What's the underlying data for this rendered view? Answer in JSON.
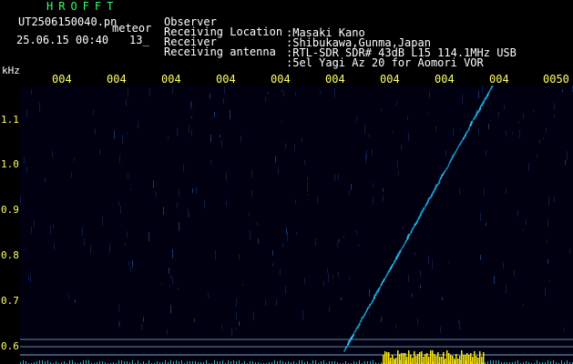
{
  "header": {
    "brand": "HROFFT",
    "filename": "UT2506150040.pn",
    "meteor_label": "meteor",
    "datetime": "25.06.15 00:40",
    "aux_value": "13_",
    "info": [
      {
        "label": "Observer",
        "value": ":Masaki Kano"
      },
      {
        "label": "Receiving Location",
        "value": ":Shibukawa,Gunma,Japan"
      },
      {
        "label": "Receiver",
        "value": ":RTL-SDR SDR# 43dB L15 114.1MHz USB"
      },
      {
        "label": "Receiving antenna",
        "value": ":5el Yagi Az 20 for Aomori VOR"
      }
    ]
  },
  "axes": {
    "y_unit": "kHz",
    "y_ticks": [
      "1.1",
      "1.0",
      "0.9",
      "0.8",
      "0.7",
      "0.6"
    ],
    "x_ticks": [
      "004",
      "004",
      "004",
      "004",
      "004",
      "004",
      "004",
      "004",
      "004",
      "0050"
    ]
  },
  "colors": {
    "header_brand": "#33ff66",
    "header_text": "#ffffff",
    "axis_text": "#ffff66",
    "plot_bg": "#000010",
    "trace": "#18a8e0",
    "reference_lines": "#7fb7d6",
    "baseline_cyan": "#38d6d6",
    "baseline_yellow": "#ffe600"
  }
}
